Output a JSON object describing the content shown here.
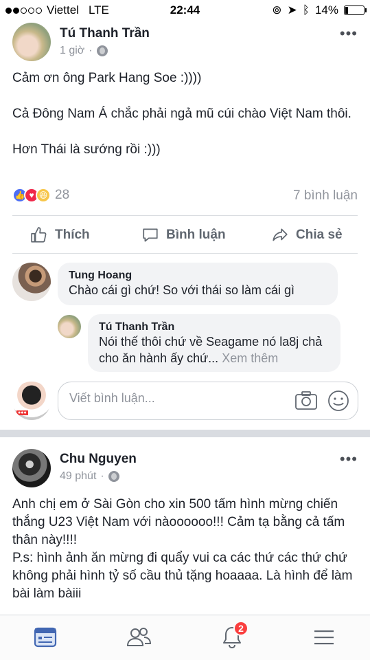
{
  "status_bar": {
    "carrier": "Viettel",
    "network": "LTE",
    "time": "22:44",
    "battery": "14%",
    "battery_level": 0.14,
    "signal_bars_filled": 2,
    "signal_bars_total": 5
  },
  "post1": {
    "author": "Tú Thanh Trần",
    "time": "1 giờ",
    "text": "Cảm ơn ông Park Hang Soe :))))\n\nCả Đông Nam Á chắc phải ngả mũ cúi chào Việt Nam thôi.\n\nHơn Thái là sướng rồi :)))",
    "reaction_count": "28",
    "comment_count": "7 bình luận",
    "actions": {
      "like": "Thích",
      "comment": "Bình luận",
      "share": "Chia sẻ"
    },
    "comments": [
      {
        "author": "Tung Hoang",
        "text": "Chào cái gì chứ! So với thái so làm cái gì"
      },
      {
        "author": "Tú Thanh Trần",
        "text": "Nói thế thôi chứ về Seagame nó la8j chả cho ăn hành ấy chứ...",
        "see_more": "Xem thêm"
      }
    ],
    "write_placeholder": "Viết bình luận..."
  },
  "post2": {
    "author": "Chu Nguyen",
    "time": "49 phút",
    "text": "Anh chị em ở Sài Gòn cho xin 500 tấm hình mừng chiến thắng U23 Việt Nam với nàoooooo!!! Cảm tạ bằng cả tấm thân này!!!!\nP.s: hình ảnh ăn mừng đi quẩy vui ca các thứ các thứ chứ không phải hình tỷ số cầu thủ tặng hoaaaa. Là hình để làm bài làm bàiii"
  },
  "tabbar": {
    "notifications_badge": "2"
  },
  "icons": {
    "privacy": "globe-icon",
    "more": "more-dots-icon",
    "like": "thumbs-up-icon",
    "comment": "comment-bubble-icon",
    "share": "share-arrow-icon",
    "camera": "camera-icon",
    "emoji": "smiley-icon"
  },
  "colors": {
    "like_blue": "#4c6ef5",
    "love_red": "#f0284a",
    "haha_yellow": "#f7c64a",
    "active_tab": "#4267b2",
    "badge_red": "#fa3e3e"
  }
}
